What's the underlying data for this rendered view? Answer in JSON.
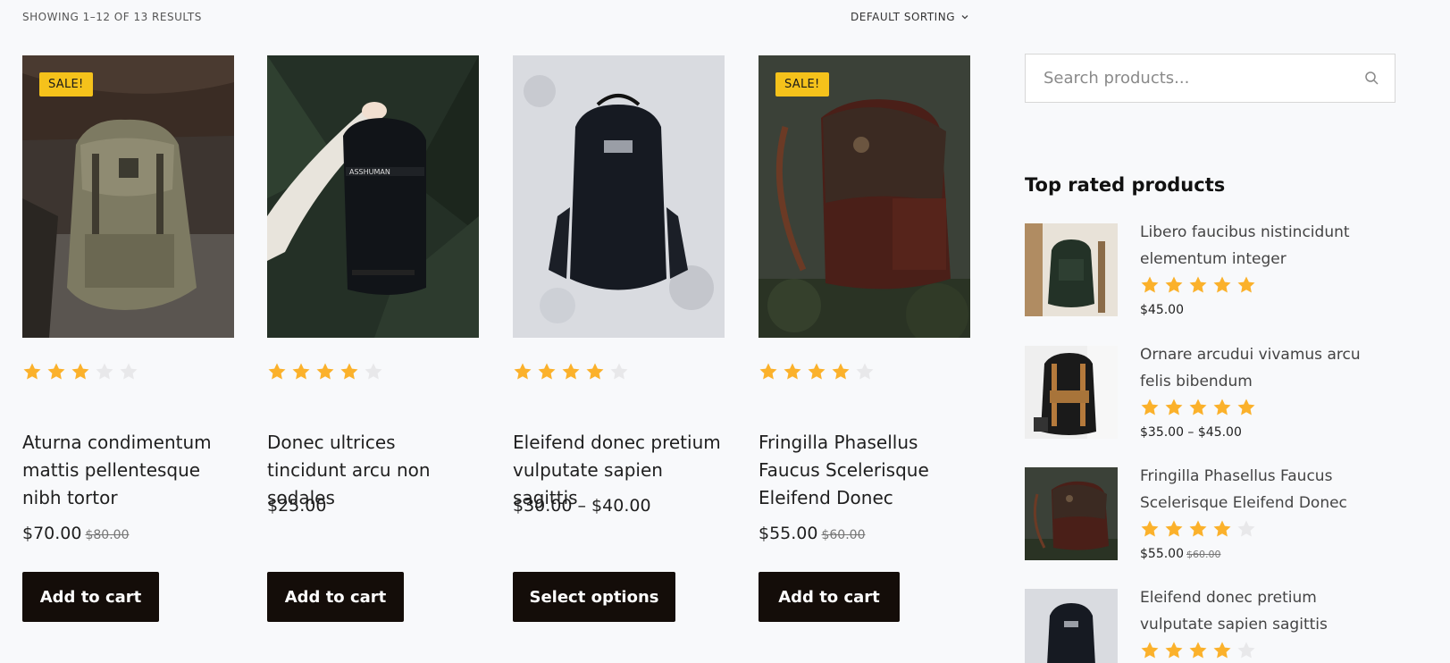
{
  "toolbar": {
    "result_count": "SHOWING 1–12 OF 13 RESULTS",
    "sorting_label": "DEFAULT SORTING"
  },
  "colors": {
    "star_filled": "#fbb12b",
    "star_empty": "#e8e8ea",
    "sale_badge": "#f5c21b",
    "button_bg": "#140d09",
    "page_bg": "#f8f9fb"
  },
  "products": [
    {
      "title": "Aturna condimentum mattis pellentesque nibh tortor",
      "price": "$70.00",
      "old_price": "$80.00",
      "sale_badge": "SALE!",
      "rating": 3,
      "button_label": "Add to cart",
      "image_icon": "olive-backpack-image"
    },
    {
      "title": "Donec ultrices tincidunt arcu non sodales",
      "price": "$25.00",
      "old_price": "",
      "sale_badge": "",
      "rating": 4,
      "button_label": "Add to cart",
      "image_icon": "black-backpack-hand-image"
    },
    {
      "title": "Eleifend donec pretium vulputate sapien sagittis",
      "price": "$30.00 – $40.00",
      "old_price": "",
      "sale_badge": "",
      "rating": 4,
      "button_label": "Select options",
      "image_icon": "black-backpack-snow-image"
    },
    {
      "title": "Fringilla Phasellus Faucus Scelerisque Eleifend Donec",
      "price": "$55.00",
      "old_price": "$60.00",
      "sale_badge": "SALE!",
      "rating": 4,
      "button_label": "Add to cart",
      "image_icon": "brown-leather-backpack-image"
    }
  ],
  "sidebar": {
    "search_placeholder": "Search products...",
    "top_rated_title": "Top rated products",
    "top_rated": [
      {
        "title": "Libero faucibus nistincidunt elementum integer",
        "rating": 5,
        "price": "$45.00",
        "old_price": "",
        "image_icon": "green-backpack-image"
      },
      {
        "title": "Ornare arcudui vivamus arcu felis bibendum",
        "rating": 5,
        "price": "$35.00 – $45.00",
        "old_price": "",
        "image_icon": "black-tan-backpack-image"
      },
      {
        "title": "Fringilla Phasellus Faucus Scelerisque Eleifend Donec",
        "rating": 4,
        "price": "$55.00",
        "old_price": "$60.00",
        "image_icon": "brown-leather-backpack-image"
      },
      {
        "title": "Eleifend donec pretium vulputate sapien sagittis",
        "rating": 4,
        "price": "",
        "old_price": "",
        "image_icon": "black-backpack-snow-image"
      }
    ]
  }
}
